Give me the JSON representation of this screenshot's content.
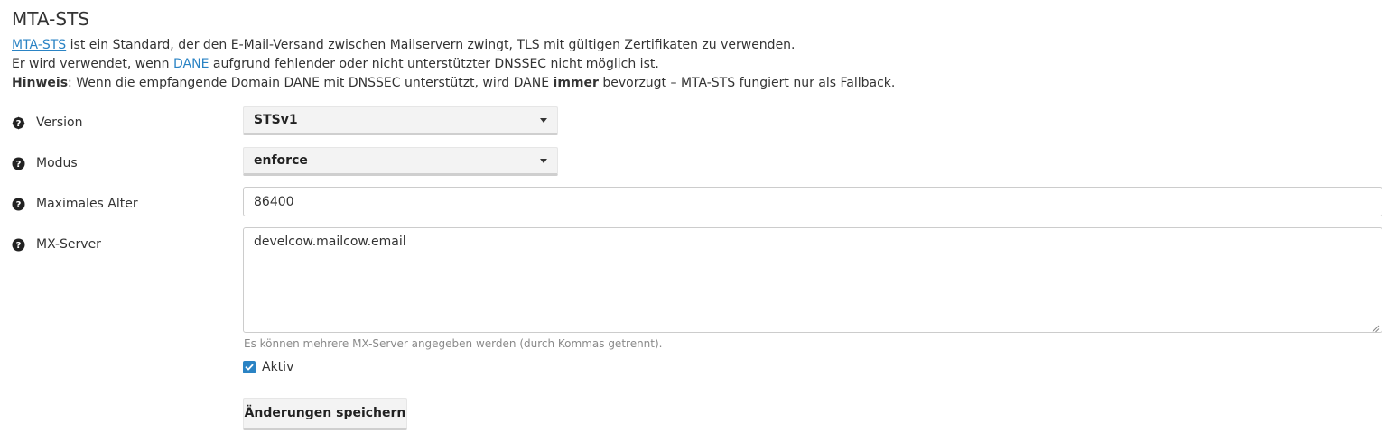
{
  "section": {
    "title": "MTA-STS"
  },
  "description": {
    "line1": {
      "link": "MTA-STS",
      "text": " ist ein Standard, der den E-Mail-Versand zwischen Mailservern zwingt, TLS mit gültigen Zertifikaten zu verwenden."
    },
    "line2": {
      "before": "Er wird verwendet, wenn ",
      "link": "DANE",
      "after": " aufgrund fehlender oder nicht unterstützter DNSSEC nicht möglich ist."
    },
    "line3": {
      "bold_label": "Hinweis",
      "text_before": ": Wenn die empfangende Domain DANE mit DNSSEC unterstützt, wird DANE ",
      "bold_word": "immer",
      "text_after": " bevorzugt – MTA-STS fungiert nur als Fallback."
    }
  },
  "form": {
    "version": {
      "label": "Version",
      "value": "STSv1"
    },
    "mode": {
      "label": "Modus",
      "value": "enforce"
    },
    "max_age": {
      "label": "Maximales Alter",
      "value": "86400"
    },
    "mx_server": {
      "label": "MX-Server",
      "value": "develcow.mailcow.email",
      "hint": "Es können mehrere MX-Server angegeben werden (durch Kommas getrennt)."
    },
    "active": {
      "label": "Aktiv",
      "checked": true
    },
    "save_label": "Änderungen speichern"
  },
  "icons": {
    "help": "question-circle-icon",
    "dropdown": "caret-down-icon",
    "check": "check-icon"
  },
  "colors": {
    "link": "#2a83c4",
    "checkbox": "#2a83c4",
    "text": "#333333",
    "hint": "#8a8a8a"
  }
}
